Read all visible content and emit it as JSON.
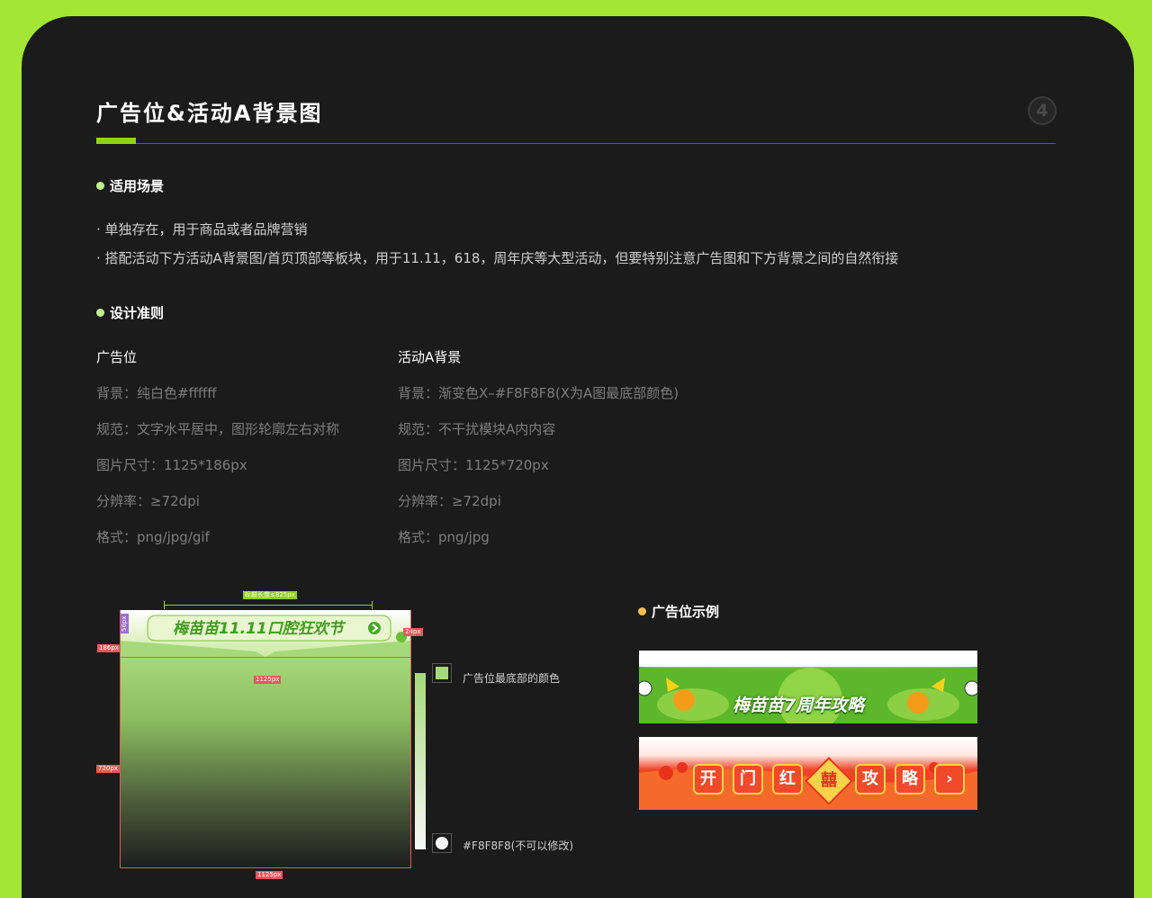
{
  "header": {
    "title": "广告位&活动A背景图",
    "page_number": "4"
  },
  "section_scenarios": {
    "heading": "适用场景",
    "bullets": [
      "· 单独存在，用于商品或者品牌营销",
      "· 搭配活动下方活动A背景图/首页顶部等板块，用于11.11，618，周年庆等大型活动，但要特别注意广告图和下方背景之间的自然衔接"
    ]
  },
  "section_guidelines": {
    "heading": "设计准则",
    "columns": [
      {
        "title": "广告位",
        "specs": [
          "背景：纯白色#ffffff",
          "规范：文字水平居中，图形轮廓左右对称",
          "图片尺寸：1125*186px",
          "分辨率：≥72dpi",
          "格式：png/jpg/gif"
        ]
      },
      {
        "title": "活动A背景",
        "specs": [
          "背景：渐变色X–#F8F8F8(X为A图最底部颜色)",
          "规范：不干扰模块A内内容",
          "图片尺寸：1125*720px",
          "分辨率：≥72dpi",
          "格式：png/jpg"
        ]
      }
    ]
  },
  "diagram": {
    "title_width_tag": "标题长度≤825px",
    "height_186_tag": "186px",
    "height_56_tag": "56px",
    "padding_24_tag": "24px",
    "width_1125_mid_tag": "1125px",
    "height_720_tag": "720px",
    "width_1125_bottom_tag": "1125px",
    "banner_text": "梅苗苗11.11口腔狂欢节",
    "swatch_top_label": "广告位最底部的颜色",
    "swatch_bottom_label": "#F8F8F8(不可以修改)",
    "colors": {
      "top": "#a6d97a",
      "bottom": "#f8f8f8"
    }
  },
  "examples": {
    "heading": "广告位示例",
    "banner1_text": "梅苗苗7周年攻略",
    "banner2_chars": [
      "开",
      "门",
      "红",
      "囍",
      "攻",
      "略"
    ]
  },
  "colors": {
    "accent": "#8ed11f",
    "outer": "#a3e635",
    "card": "#1b1b1b",
    "example_dot": "#f5c04a"
  }
}
